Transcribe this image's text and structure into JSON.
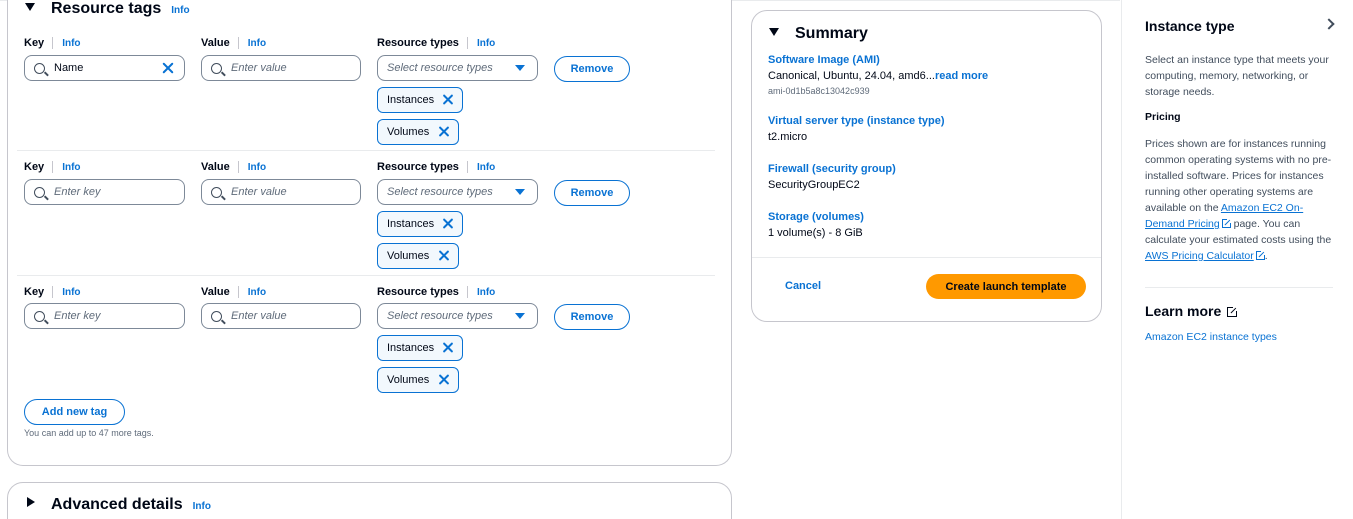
{
  "resource_tags": {
    "title": "Resource tags",
    "info": "Info",
    "labels": {
      "key": "Key",
      "value": "Value",
      "resource_types": "Resource types",
      "info": "Info"
    },
    "key_placeholder": "Enter key",
    "value_placeholder": "Enter value",
    "resource_types_placeholder": "Select resource types",
    "remove_label": "Remove",
    "rows": [
      {
        "key": "Name",
        "tokens": [
          "Instances",
          "Volumes"
        ]
      },
      {
        "key": "",
        "tokens": [
          "Instances",
          "Volumes"
        ]
      },
      {
        "key": "",
        "tokens": [
          "Instances",
          "Volumes"
        ]
      }
    ],
    "add_new_tag": "Add new tag",
    "hint": "You can add up to 47 more tags."
  },
  "advanced_details": {
    "title": "Advanced details",
    "info": "Info"
  },
  "summary": {
    "title": "Summary",
    "ami_label": "Software Image (AMI)",
    "ami_value": "Canonical, Ubuntu, 24.04, amd6...",
    "ami_read_more": "read more",
    "ami_id": "ami-0d1b5a8c13042c939",
    "instance_type_label": "Virtual server type (instance type)",
    "instance_type_value": "t2.micro",
    "firewall_label": "Firewall (security group)",
    "firewall_value": "SecurityGroupEC2",
    "storage_label": "Storage (volumes)",
    "storage_value": "1 volume(s) - 8 GiB",
    "cancel": "Cancel",
    "create": "Create launch template"
  },
  "help": {
    "title": "Instance type",
    "intro": "Select an instance type that meets your computing, memory, networking, or storage needs.",
    "pricing_title": "Pricing",
    "pricing_text": "Prices shown are for instances running common operating systems with no pre-installed software. Prices for instances running other operating systems are available on the",
    "pricing_link": "Amazon EC2 On-Demand Pricing",
    "pricing_text2": "page. You can calculate your estimated costs using the",
    "calculator_link": "AWS Pricing Calculator",
    "period": ".",
    "learn_more": "Learn more",
    "learn_link": "Amazon EC2 instance types"
  }
}
